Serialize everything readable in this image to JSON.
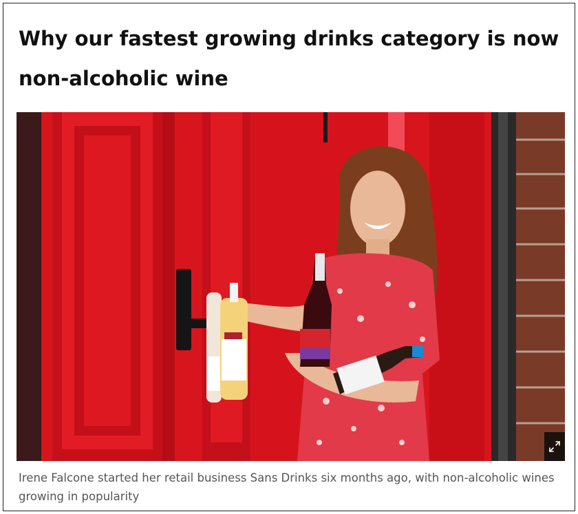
{
  "article": {
    "headline": "Why our fastest growing drinks category is now non-alcoholic wine",
    "photo": {
      "icon": "expand-icon",
      "caption": "Irene Falcone started her retail business Sans Drinks six months ago, with non-alcoholic wines growing in popularity"
    }
  },
  "colors": {
    "door_red": "#d8141c",
    "brick": "#7a3a28",
    "text_dark": "#111111",
    "caption_grey": "#555555"
  }
}
